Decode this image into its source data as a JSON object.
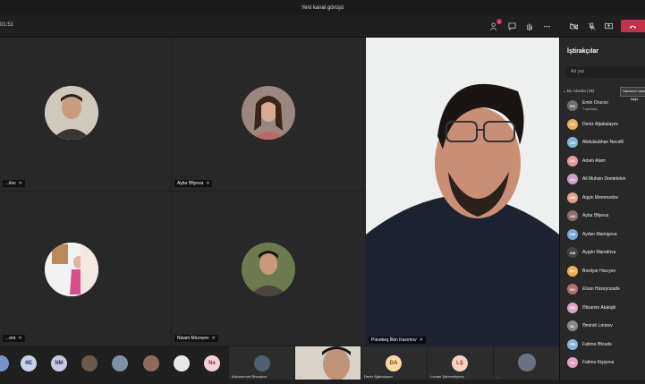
{
  "window": {
    "title": "Yeni kanal görüşü"
  },
  "toolbar": {
    "timer": "01:51",
    "participants_badge": "1"
  },
  "tiles": [
    {
      "name": "...ilov"
    },
    {
      "name": "Aybə Əliyeva"
    },
    {
      "name": "...ərə"
    },
    {
      "name": "Nizam Mirzəyev"
    }
  ],
  "main_video": {
    "name": "Pünəkeş İlkin Kazımov"
  },
  "strip": {
    "avatars": [
      "ƏE",
      "NM",
      "Nə"
    ],
    "tiles": [
      "Məhəmməd Əhmədov",
      "...",
      "Deniz Ağabalayev",
      "Ləman Şahverdiyeva",
      "..."
    ],
    "tile_initials": [
      "DA",
      "LŞ"
    ]
  },
  "panel": {
    "title": "İştirakçılar",
    "search_placeholder": "Ad yaz",
    "section_label": "Bu iclasda (49)",
    "mute_all": "Hamısının səsini bağla",
    "participants": [
      {
        "name": "Emin Orucov",
        "role": "Təşkilatçı",
        "initials": "EO",
        "color": "#6e6e6e"
      },
      {
        "name": "Deniz Ağabalayev",
        "initials": "DA",
        "color": "#e8b05a"
      },
      {
        "name": "Abdulsubhan Necəfli",
        "initials": "AN",
        "color": "#8ab4d6"
      },
      {
        "name": "Adəm Atam",
        "initials": "AA",
        "color": "#e09c9c"
      },
      {
        "name": "Ali Muhsin Demirtekin",
        "initials": "AD",
        "color": "#c9a0c9"
      },
      {
        "name": "Aqşin Məmmədov",
        "initials": "AM",
        "color": "#e0a090"
      },
      {
        "name": "Ayba Əliyeva",
        "initials": "AƏ",
        "color": "#8c6f6f"
      },
      {
        "name": "Aydan Mamigova",
        "initials": "AM",
        "color": "#7aa7d6"
      },
      {
        "name": "Aygün Manafova",
        "initials": "AM",
        "color": "#444444"
      },
      {
        "name": "Bəsliyər Hacıyev",
        "initials": "BH",
        "color": "#e8b05a"
      },
      {
        "name": "Elxan Hüseynzadə",
        "initials": "EH",
        "color": "#b07070"
      },
      {
        "name": "Əlizamin Atakişili",
        "initials": "ƏA",
        "color": "#d8a7c6"
      },
      {
        "name": "Əmirəh Lminov",
        "initials": "ƏL",
        "color": "#888888"
      },
      {
        "name": "Fatimə Əfzədə",
        "initials": "FƏ",
        "color": "#8ab4d6"
      },
      {
        "name": "Fatimə Kişiyeva",
        "initials": "FK",
        "color": "#e0a0c0"
      }
    ]
  }
}
